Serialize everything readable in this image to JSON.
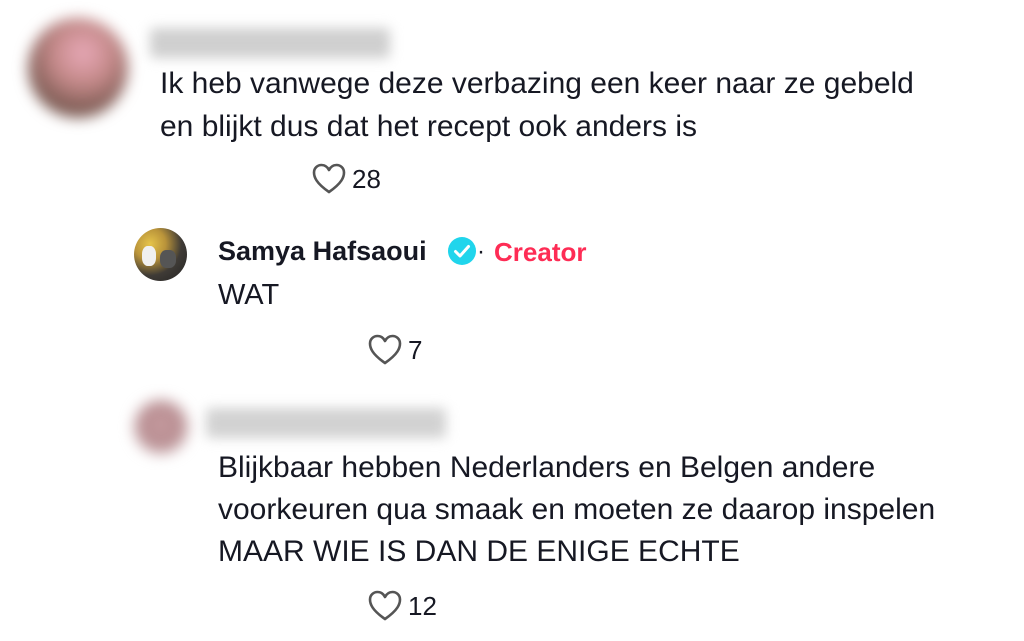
{
  "comments": [
    {
      "text_lines": [
        "Ik heb vanwege deze verbazing een keer naar ze gebeld",
        "en blijkt dus dat het recept ook anders is"
      ],
      "likes": "28"
    },
    {
      "username": "Samya Hafsaoui",
      "verified": true,
      "separator": "·",
      "badge": "Creator",
      "text_lines": [
        "WAT"
      ],
      "likes": "7"
    },
    {
      "text_lines": [
        "Blijkbaar hebben Nederlanders en Belgen andere",
        "voorkeuren qua smaak en moeten ze daarop inspelen",
        "MAAR WIE IS DAN DE ENIGE ECHTE"
      ],
      "likes": "12"
    }
  ],
  "colors": {
    "creator_badge": "#fe2c55",
    "verified_badge": "#20d5ec",
    "text": "#161823",
    "like_icon": "#555555"
  },
  "icons": {
    "like": "heart-outline-icon",
    "verified": "verified-check-icon"
  }
}
